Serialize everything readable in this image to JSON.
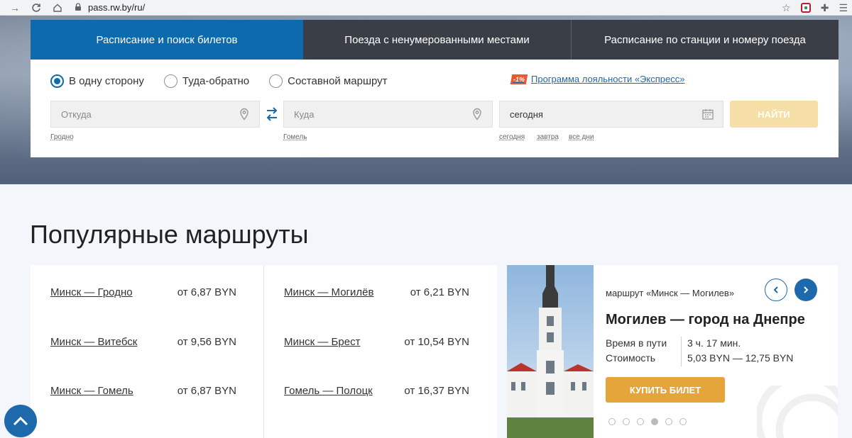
{
  "browser": {
    "url": "pass.rw.by/ru/"
  },
  "tabs": [
    {
      "label": "Расписание и поиск билетов",
      "active": true
    },
    {
      "label": "Поезда с ненумерованными местами",
      "active": false
    },
    {
      "label": "Расписание по станции и номеру поезда",
      "active": false
    }
  ],
  "search": {
    "trip_types": [
      {
        "label": "В одну сторону",
        "checked": true
      },
      {
        "label": "Туда-обратно",
        "checked": false
      },
      {
        "label": "Составной маршрут",
        "checked": false
      }
    ],
    "loyalty_badge": "-1%",
    "loyalty_link": "Программа лояльности «Экспресс»",
    "from_placeholder": "Откуда",
    "to_placeholder": "Куда",
    "date_value": "сегодня",
    "find_label": "НАЙТИ",
    "from_hint": "Гродно",
    "to_hint": "Гомель",
    "date_hints": [
      "сегодня",
      "завтра",
      "все дни"
    ]
  },
  "popular": {
    "title": "Популярные маршруты",
    "routes": [
      {
        "name": "Минск — Гродно",
        "price": "от 6,87 BYN"
      },
      {
        "name": "Минск — Витебск",
        "price": "от 9,56 BYN"
      },
      {
        "name": "Минск — Гомель",
        "price": "от 6,87 BYN"
      },
      {
        "name": "Минск — Могилёв",
        "price": "от 6,21 BYN"
      },
      {
        "name": "Минск — Брест",
        "price": "от 10,54 BYN"
      },
      {
        "name": "Гомель — Полоцк",
        "price": "от 16,37 BYN"
      }
    ]
  },
  "promo": {
    "subtitle": "маршрут «Минск — Могилев»",
    "title": "Могилев — город на Днепре",
    "travel_label": "Время в пути",
    "travel_value": "3 ч. 17 мин.",
    "cost_label": "Стоимость",
    "cost_value": "5,03 BYN — 12,75 BYN",
    "buy_label": "КУПИТЬ БИЛЕТ",
    "slides": 6,
    "active_slide": 4
  },
  "colors": {
    "brand_blue": "#0d6aad",
    "link_blue": "#1e69ab",
    "buy_orange": "#e6a53a",
    "find_disabled": "#f6dfa6"
  }
}
